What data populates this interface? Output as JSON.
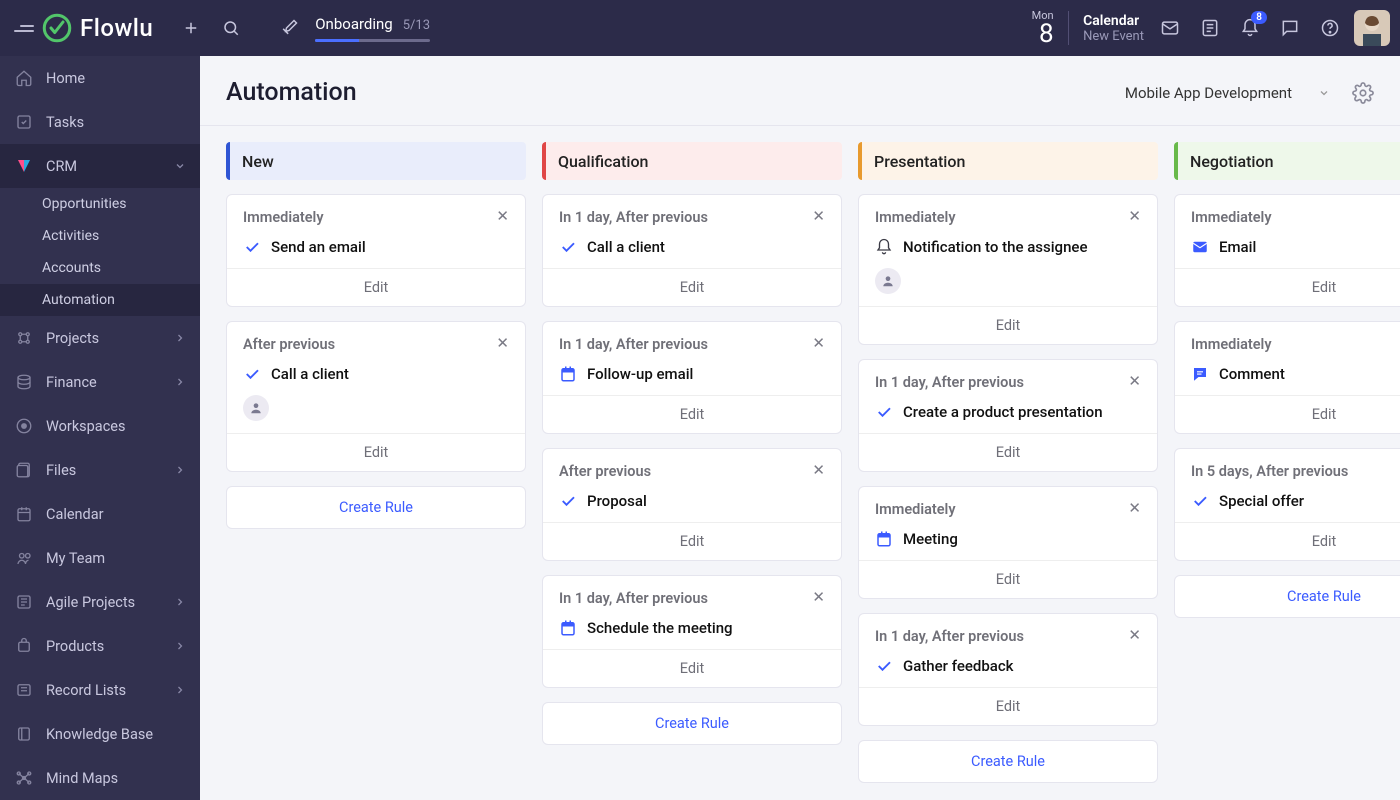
{
  "app_name": "Flowlu",
  "onboarding": {
    "label": "Onboarding",
    "count": "5/13",
    "progress_pct": 38
  },
  "date": {
    "dow": "Mon",
    "day": "8"
  },
  "calendar_widget": {
    "title": "Calendar",
    "subtitle": "New Event"
  },
  "notifications_count": "8",
  "sidebar": {
    "items": [
      {
        "label": "Home",
        "icon": "home",
        "expandable": false
      },
      {
        "label": "Tasks",
        "icon": "tasks",
        "expandable": false
      },
      {
        "label": "CRM",
        "icon": "crm",
        "expandable": true,
        "active": true,
        "children": [
          "Opportunities",
          "Activities",
          "Accounts",
          "Automation"
        ],
        "selected_child": 3
      },
      {
        "label": "Projects",
        "icon": "projects",
        "expandable": true
      },
      {
        "label": "Finance",
        "icon": "finance",
        "expandable": true
      },
      {
        "label": "Workspaces",
        "icon": "workspaces",
        "expandable": false
      },
      {
        "label": "Files",
        "icon": "files",
        "expandable": true
      },
      {
        "label": "Calendar",
        "icon": "calendar",
        "expandable": false
      },
      {
        "label": "My Team",
        "icon": "team",
        "expandable": false
      },
      {
        "label": "Agile Projects",
        "icon": "agile",
        "expandable": true
      },
      {
        "label": "Products",
        "icon": "products",
        "expandable": true
      },
      {
        "label": "Record Lists",
        "icon": "records",
        "expandable": true
      },
      {
        "label": "Knowledge Base",
        "icon": "kb",
        "expandable": false
      },
      {
        "label": "Mind Maps",
        "icon": "mindmap",
        "expandable": false
      }
    ]
  },
  "page": {
    "title": "Automation",
    "project": "Mobile App Development"
  },
  "labels": {
    "edit": "Edit",
    "create_rule": "Create Rule"
  },
  "columns": [
    {
      "name": "New",
      "css": "c-new",
      "cards": [
        {
          "when": "Immediately",
          "icon": "check",
          "title": "Send an email"
        },
        {
          "when": "After previous",
          "icon": "check",
          "title": "Call a client",
          "avatar": true
        }
      ]
    },
    {
      "name": "Qualification",
      "css": "c-qual",
      "cards": [
        {
          "when": "In 1 day, After previous",
          "icon": "check",
          "title": "Call a client"
        },
        {
          "when": "In 1 day, After previous",
          "icon": "cal",
          "title": "Follow-up email"
        },
        {
          "when": "After previous",
          "icon": "check",
          "title": "Proposal"
        },
        {
          "when": "In 1 day, After previous",
          "icon": "cal",
          "title": "Schedule the meeting"
        }
      ]
    },
    {
      "name": "Presentation",
      "css": "c-pres",
      "cards": [
        {
          "when": "Immediately",
          "icon": "bell",
          "title": "Notification to the assignee",
          "avatar": true
        },
        {
          "when": "In 1 day, After previous",
          "icon": "check",
          "title": "Create a product presentation"
        },
        {
          "when": "Immediately",
          "icon": "cal",
          "title": "Meeting"
        },
        {
          "when": "In 1 day, After previous",
          "icon": "check",
          "title": "Gather feedback"
        }
      ]
    },
    {
      "name": "Negotiation",
      "css": "c-neg",
      "cards": [
        {
          "when": "Immediately",
          "icon": "mail",
          "title": "Email"
        },
        {
          "when": "Immediately",
          "icon": "comment",
          "title": "Comment"
        },
        {
          "when": "In 5 days, After previous",
          "icon": "check",
          "title": "Special offer"
        }
      ]
    }
  ]
}
